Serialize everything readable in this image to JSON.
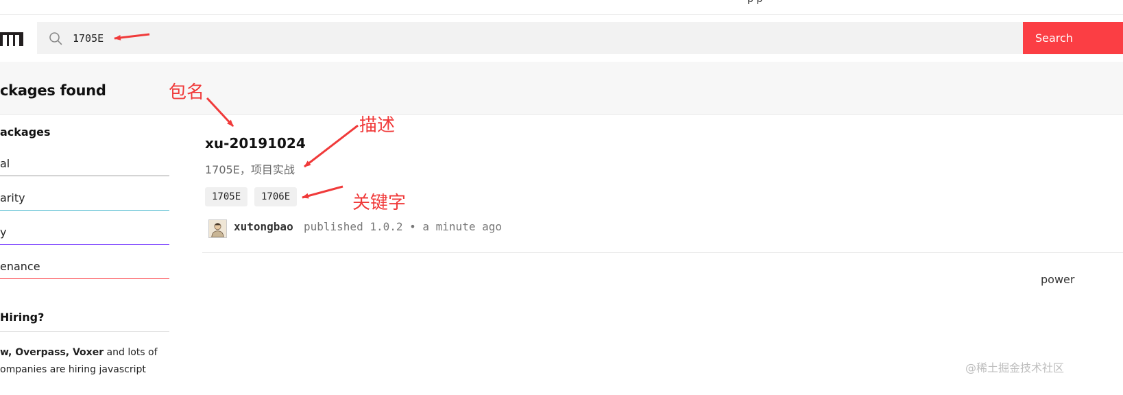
{
  "header": {
    "top_fragment": "p  p",
    "search": {
      "value": "1705E",
      "button_label": "Search"
    }
  },
  "results": {
    "title": "ckages found"
  },
  "sidebar": {
    "sort_heading": "ackages",
    "sort_items": [
      {
        "label": "al",
        "color": "#999999"
      },
      {
        "label": "arity",
        "color": "#35b0c8"
      },
      {
        "label": "y",
        "color": "#8956ff"
      },
      {
        "label": "enance",
        "color": "#fb3e44"
      }
    ],
    "hiring_heading": " Hiring?",
    "hiring_text_line1_bold": "w, Overpass, Voxer",
    "hiring_text_line1_rest": " and lots of",
    "hiring_text_line2": "ompanies are hiring javascript"
  },
  "package": {
    "name": "xu-20191024",
    "description": "1705E，项目实战",
    "keywords": [
      "1705E",
      "1706E"
    ],
    "publisher": "xutongbao",
    "published_meta": "published 1.0.2 • a minute ago"
  },
  "footer": {
    "powered_fragment": "power"
  },
  "annotations": {
    "name_label": "包名",
    "desc_label": "描述",
    "keywords_label": "关键字",
    "color": "#f03a3a"
  },
  "watermark": "@稀土掘金技术社区"
}
